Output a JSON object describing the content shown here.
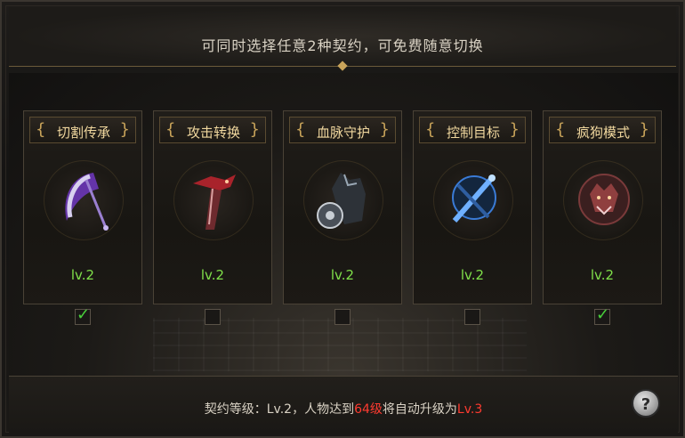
{
  "header": {
    "title": "可同时选择任意2种契约，可免费随意切换"
  },
  "cards": [
    {
      "title": "切割传承",
      "level": "lv.2",
      "selected": true,
      "icon": "scythe-icon",
      "color": "#8b4bd6"
    },
    {
      "title": "攻击转换",
      "level": "lv.2",
      "selected": false,
      "icon": "dragon-blade-icon",
      "color": "#c0333a"
    },
    {
      "title": "血脉守护",
      "level": "lv.2",
      "selected": false,
      "icon": "wolf-shield-icon",
      "color": "#8fa3b8"
    },
    {
      "title": "控制目标",
      "level": "lv.2",
      "selected": false,
      "icon": "blue-chains-icon",
      "color": "#3a7bd6"
    },
    {
      "title": "疯狗模式",
      "level": "lv.2",
      "selected": true,
      "icon": "werewolf-icon",
      "color": "#b04a4a"
    }
  ],
  "footer": {
    "prefix": "契约等级：Lv.2，人物达到",
    "level_required": "64级",
    "middle": "将自动升级为",
    "next_level": "Lv.3"
  },
  "help": {
    "label": "?"
  }
}
